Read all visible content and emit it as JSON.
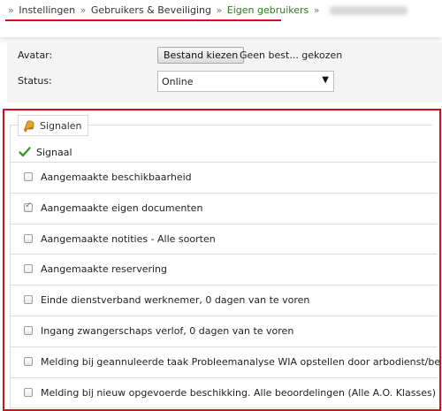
{
  "breadcrumb": {
    "items": [
      "Instellingen",
      "Gebruikers & Beveiliging",
      "Eigen gebruikers"
    ],
    "separator": "»"
  },
  "form": {
    "avatar_label": "Avatar:",
    "file_button": "Bestand kiezen",
    "file_status": "Geen best... gekozen",
    "status_label": "Status:",
    "status_value": "Online"
  },
  "signals": {
    "legend": "Signalen",
    "header": "Signaal",
    "items": [
      {
        "label": "Aangemaakte beschikbaarheid",
        "checked": false
      },
      {
        "label": "Aangemaakte eigen documenten",
        "checked": true
      },
      {
        "label": "Aangemaakte notities - Alle soorten",
        "checked": false
      },
      {
        "label": "Aangemaakte reservering",
        "checked": false
      },
      {
        "label": "Einde dienstverband werknemer, 0 dagen van te voren",
        "checked": false
      },
      {
        "label": "Ingang zwangerschaps verlof, 0 dagen van te voren",
        "checked": false
      },
      {
        "label": "Melding bij geannuleerde taak Probleemanalyse WIA opstellen door arbodienst/bedrijfsarts",
        "checked": false
      },
      {
        "label": "Melding bij nieuw opgevoerde beschikking. Alle beoordelingen (Alle A.O. Klasses)",
        "checked": false
      }
    ]
  },
  "colors": {
    "highlight": "#d0101b",
    "link_green": "#2a7a1b"
  }
}
